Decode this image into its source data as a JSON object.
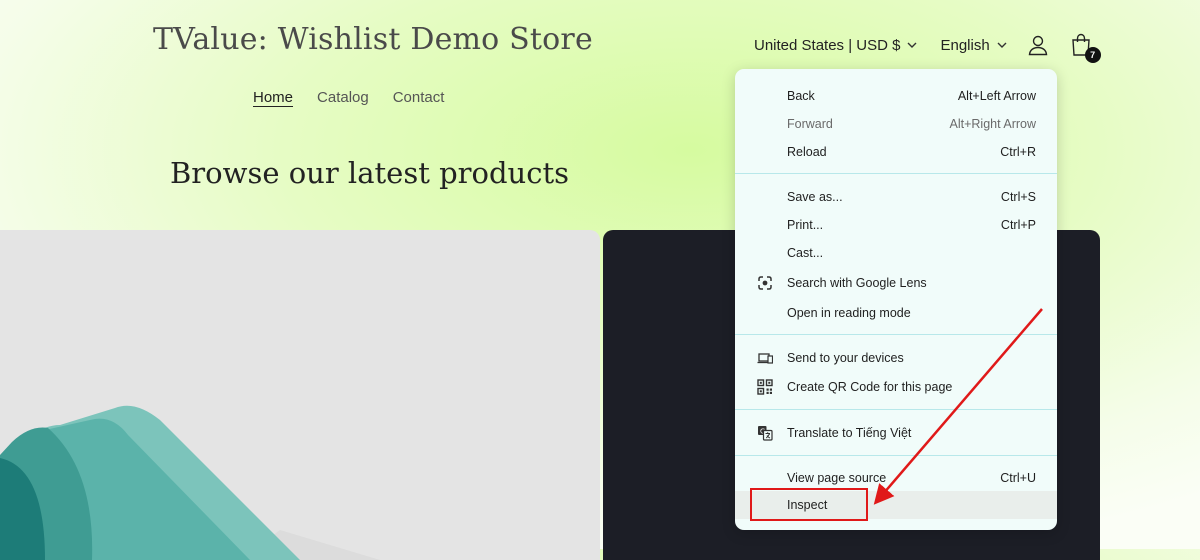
{
  "store": {
    "title": "TValue: Wishlist Demo Store"
  },
  "nav": {
    "items": [
      {
        "label": "Home"
      },
      {
        "label": "Catalog"
      },
      {
        "label": "Contact"
      }
    ]
  },
  "header": {
    "country_selector": "United States | USD $",
    "language_selector": "English",
    "cart_count": "7",
    "icons": {
      "chevron": "chevron-down-icon",
      "account": "user-icon",
      "cart": "shopping-bag-icon"
    }
  },
  "section": {
    "heading": "Browse our latest products"
  },
  "context_menu": {
    "back": {
      "label": "Back",
      "shortcut": "Alt+Left Arrow"
    },
    "forward": {
      "label": "Forward",
      "shortcut": "Alt+Right Arrow"
    },
    "reload": {
      "label": "Reload",
      "shortcut": "Ctrl+R"
    },
    "save_as": {
      "label": "Save as...",
      "shortcut": "Ctrl+S"
    },
    "print": {
      "label": "Print...",
      "shortcut": "Ctrl+P"
    },
    "cast": {
      "label": "Cast..."
    },
    "google_lens": {
      "label": "Search with Google Lens",
      "icon": "google-lens-icon"
    },
    "reading_mode": {
      "label": "Open in reading mode"
    },
    "send_devices": {
      "label": "Send to your devices",
      "icon": "devices-icon"
    },
    "qr_code": {
      "label": "Create QR Code for this page",
      "icon": "qr-code-icon"
    },
    "translate": {
      "label": "Translate to Tiếng Việt",
      "icon": "translate-icon"
    },
    "view_source": {
      "label": "View page source",
      "shortcut": "Ctrl+U"
    },
    "inspect": {
      "label": "Inspect"
    }
  },
  "colors": {
    "background_accent": "#d6fba0",
    "menu_background": "#f1fcfa",
    "menu_separator": "#b8e8ea",
    "annotation_red": "#e01919",
    "dark_card": "#1c1e26",
    "light_card": "#e4e4e4",
    "teal_illustration": "#5bb3aa"
  }
}
